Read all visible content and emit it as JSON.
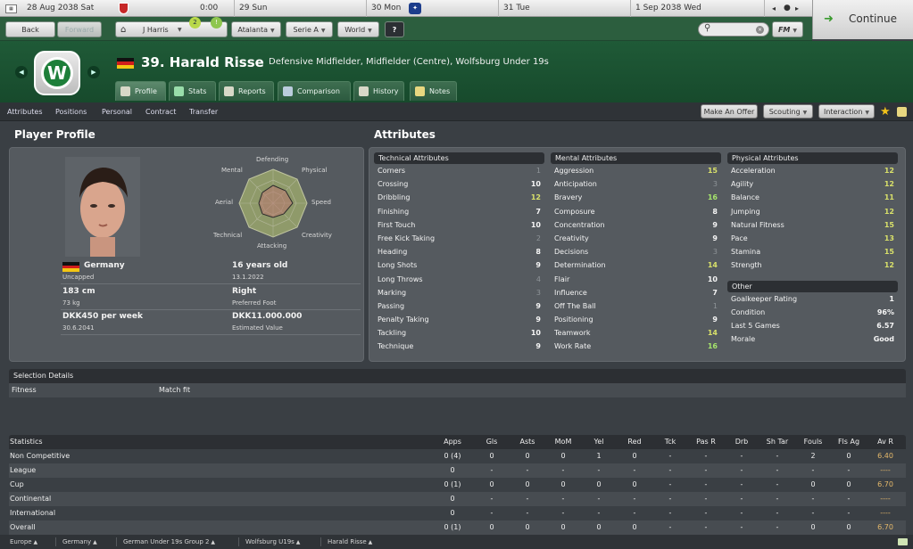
{
  "calendar": {
    "days": [
      {
        "date": "28 Aug 2038",
        "day": "Sat",
        "time": "0:00"
      },
      {
        "date": "29",
        "day": "Sun"
      },
      {
        "date": "30",
        "day": "Mon"
      },
      {
        "date": "31",
        "day": "Tue"
      },
      {
        "date": "1 Sep 2038",
        "day": "Wed"
      }
    ]
  },
  "continue_label": "Continue",
  "nav": {
    "back": "Back",
    "forward": "Forward",
    "manager": "J Harris",
    "badge1": "2",
    "badge2": "!",
    "club": "Atalanta",
    "league": "Serie A",
    "world": "World",
    "fm": "FM"
  },
  "player": {
    "number_name": "39. Harald Risse",
    "description": "Defensive Midfielder, Midfielder (Centre), Wolfsburg Under 19s"
  },
  "club_logo_letter": "W",
  "tabs": [
    "Profile",
    "Stats",
    "Reports",
    "Comparison",
    "History",
    "Notes"
  ],
  "subnav": {
    "items": [
      "Attributes",
      "Positions",
      "Personal",
      "Contract",
      "Transfer"
    ],
    "make_offer": "Make An Offer",
    "scouting": "Scouting",
    "interaction": "Interaction"
  },
  "profile": {
    "title": "Player Profile",
    "radar_labels": {
      "defending": "Defending",
      "physical": "Physical",
      "speed": "Speed",
      "creativity": "Creativity",
      "attacking": "Attacking",
      "technical": "Technical",
      "aerial": "Aerial",
      "mental": "Mental"
    },
    "nationality": "Germany",
    "caps": "Uncapped",
    "age": "16 years old",
    "dob": "13.1.2022",
    "height": "183 cm",
    "weight": "73 kg",
    "foot": "Right",
    "foot_label": "Preferred Foot",
    "wage": "DKK450 per week",
    "contract_end": "30.6.2041",
    "value": "DKK11.000.000",
    "value_label": "Estimated Value"
  },
  "attributes": {
    "title": "Attributes",
    "technical": {
      "title": "Technical Attributes",
      "rows": [
        {
          "name": "Corners",
          "value": "1"
        },
        {
          "name": "Crossing",
          "value": "10"
        },
        {
          "name": "Dribbling",
          "value": "12"
        },
        {
          "name": "Finishing",
          "value": "7"
        },
        {
          "name": "First Touch",
          "value": "10"
        },
        {
          "name": "Free Kick Taking",
          "value": "2"
        },
        {
          "name": "Heading",
          "value": "8"
        },
        {
          "name": "Long Shots",
          "value": "9"
        },
        {
          "name": "Long Throws",
          "value": "4"
        },
        {
          "name": "Marking",
          "value": "3"
        },
        {
          "name": "Passing",
          "value": "9"
        },
        {
          "name": "Penalty Taking",
          "value": "9"
        },
        {
          "name": "Tackling",
          "value": "10"
        },
        {
          "name": "Technique",
          "value": "9"
        }
      ]
    },
    "mental": {
      "title": "Mental Attributes",
      "rows": [
        {
          "name": "Aggression",
          "value": "15"
        },
        {
          "name": "Anticipation",
          "value": "3"
        },
        {
          "name": "Bravery",
          "value": "16"
        },
        {
          "name": "Composure",
          "value": "8"
        },
        {
          "name": "Concentration",
          "value": "9"
        },
        {
          "name": "Creativity",
          "value": "9"
        },
        {
          "name": "Decisions",
          "value": "3"
        },
        {
          "name": "Determination",
          "value": "14"
        },
        {
          "name": "Flair",
          "value": "10"
        },
        {
          "name": "Influence",
          "value": "7"
        },
        {
          "name": "Off The Ball",
          "value": "1"
        },
        {
          "name": "Positioning",
          "value": "9"
        },
        {
          "name": "Teamwork",
          "value": "14"
        },
        {
          "name": "Work Rate",
          "value": "16"
        }
      ]
    },
    "physical": {
      "title": "Physical Attributes",
      "rows": [
        {
          "name": "Acceleration",
          "value": "12"
        },
        {
          "name": "Agility",
          "value": "12"
        },
        {
          "name": "Balance",
          "value": "11"
        },
        {
          "name": "Jumping",
          "value": "12"
        },
        {
          "name": "Natural Fitness",
          "value": "15"
        },
        {
          "name": "Pace",
          "value": "13"
        },
        {
          "name": "Stamina",
          "value": "15"
        },
        {
          "name": "Strength",
          "value": "12"
        }
      ]
    },
    "other": {
      "title": "Other",
      "rows": [
        {
          "name": "Goalkeeper Rating",
          "value": "1"
        },
        {
          "name": "Condition",
          "value": "96%"
        },
        {
          "name": "Last 5 Games",
          "value": "6.57"
        },
        {
          "name": "Morale",
          "value": "Good"
        }
      ]
    }
  },
  "selection": {
    "title": "Selection Details",
    "label": "Fitness",
    "value": "Match fit"
  },
  "statistics": {
    "columns": [
      "Statistics",
      "Apps",
      "Gls",
      "Asts",
      "MoM",
      "Yel",
      "Red",
      "Tck",
      "Pas R",
      "Drb",
      "Sh Tar",
      "Fouls",
      "Fls Ag",
      "Av R"
    ],
    "rows": [
      [
        "Non Competitive",
        "0 (4)",
        "0",
        "0",
        "0",
        "1",
        "0",
        "-",
        "-",
        "-",
        "-",
        "2",
        "0",
        "6.40"
      ],
      [
        "League",
        "0",
        "-",
        "-",
        "-",
        "-",
        "-",
        "-",
        "-",
        "-",
        "-",
        "-",
        "-",
        "----"
      ],
      [
        "Cup",
        "0 (1)",
        "0",
        "0",
        "0",
        "0",
        "0",
        "-",
        "-",
        "-",
        "-",
        "0",
        "0",
        "6.70"
      ],
      [
        "Continental",
        "0",
        "-",
        "-",
        "-",
        "-",
        "-",
        "-",
        "-",
        "-",
        "-",
        "-",
        "-",
        "----"
      ],
      [
        "International",
        "0",
        "-",
        "-",
        "-",
        "-",
        "-",
        "-",
        "-",
        "-",
        "-",
        "-",
        "-",
        "----"
      ],
      [
        "Overall",
        "0 (1)",
        "0",
        "0",
        "0",
        "0",
        "0",
        "-",
        "-",
        "-",
        "-",
        "0",
        "0",
        "6.70"
      ]
    ]
  },
  "breadcrumbs": [
    "Europe",
    "Germany",
    "German Under 19s Group 2",
    "Wolfsburg U19s",
    "Harald Risse"
  ]
}
